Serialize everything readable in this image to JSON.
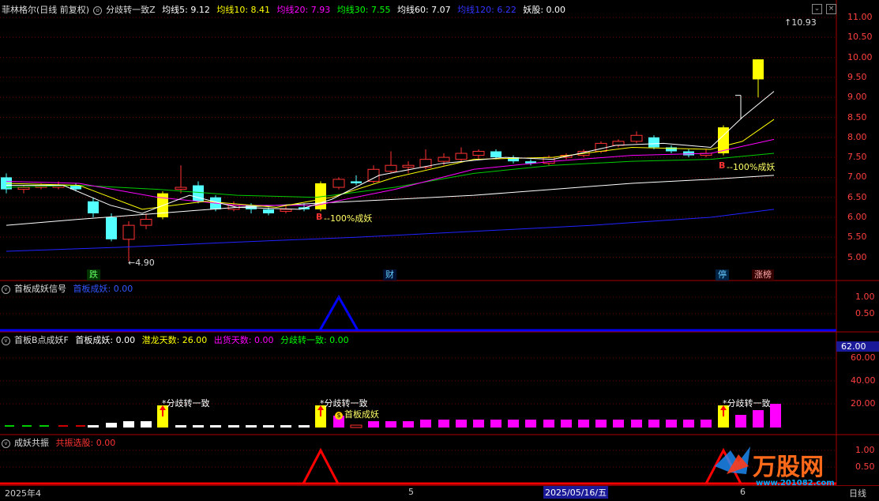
{
  "main_header": {
    "title": "菲林格尔(日线 前复权)",
    "indicator": "分歧转一致Z",
    "ma5": "均线5: 9.12",
    "ma10": "均线10: 8.41",
    "ma20": "均线20: 7.93",
    "ma30": "均线30: 7.55",
    "ma60": "均线60: 7.07",
    "ma120": "均线120: 6.22",
    "yaogu": "妖股: 0.00"
  },
  "main_axis": [
    "11.00",
    "10.50",
    "10.00",
    "9.50",
    "9.00",
    "8.50",
    "8.00",
    "7.50",
    "7.00",
    "6.50",
    "6.00",
    "5.50",
    "5.00"
  ],
  "annotations": {
    "high": "10.93",
    "low": "4.90",
    "b1_text": "--100%成妖",
    "b2_text": "--100%成妖",
    "b_letter": "B",
    "tag_die": "跌",
    "tag_cai": "财",
    "tag_ting": "停",
    "tag_zhangbang": "涨榜"
  },
  "panel1": {
    "title": "首板成妖信号",
    "label": "首板成妖: 0.00",
    "axis": [
      "1.00",
      "0.50"
    ]
  },
  "panel2": {
    "title": "首板B点成妖F",
    "shouban": "首板成妖: 0.00",
    "qianlong": "潜龙天数: 26.00",
    "chuhuo": "出货天数: 0.00",
    "fenqi": "分歧转一致: 0.00",
    "axis_top": "62.00",
    "axis": [
      "60.00",
      "40.00",
      "20.00"
    ],
    "sig1": "*分歧转一致",
    "sig2": "*分歧转一致",
    "sig3": "*分歧转一致",
    "shouban_tag": "首板成妖"
  },
  "panel3": {
    "title": "成妖共振",
    "label": "共振选股: 0.00",
    "axis": [
      "1.00",
      "0.50"
    ]
  },
  "bottom": {
    "d1": "2025年4",
    "d2": "5",
    "d3": "2025/05/16/五",
    "d4": "6",
    "period": "日线"
  },
  "watermark": {
    "brand": "万股网",
    "url": "www.201082.com"
  },
  "colors": {
    "up": "#ff3333",
    "down": "#54ffff",
    "yellow": "#ffff00",
    "ma5": "#ffffff",
    "ma10": "#ffff00",
    "ma20": "#ff00ff",
    "ma30": "#00ff00",
    "ma60": "#ffffff",
    "ma120": "#0000ff"
  }
}
